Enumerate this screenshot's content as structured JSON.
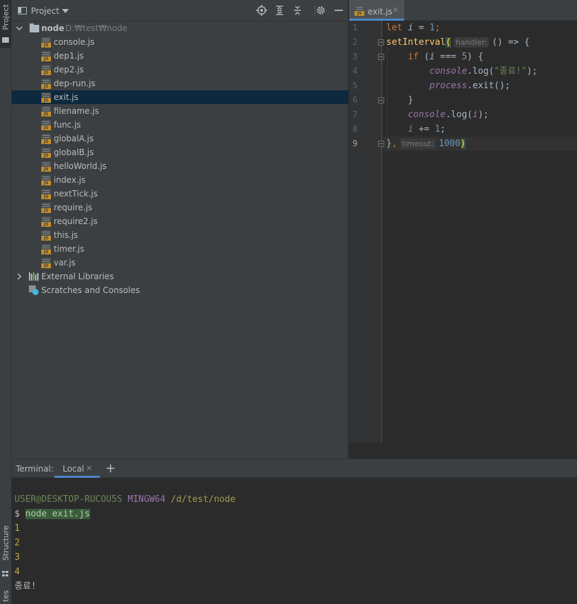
{
  "sidebar_strip": {
    "project_label": "Project",
    "structure_label": "Structure",
    "favorites_label": "tes"
  },
  "project_panel": {
    "title": "Project",
    "root": {
      "name": "node",
      "path": "D:₩test₩node"
    },
    "files": [
      "console.js",
      "dep1.js",
      "dep2.js",
      "dep-run.js",
      "exit.js",
      "filename.js",
      "func.js",
      "globalA.js",
      "globalB.js",
      "helloWorld.js",
      "index.js",
      "nextTick.js",
      "require.js",
      "require2.js",
      "this.js",
      "timer.js",
      "var.js"
    ],
    "selected_file": "exit.js",
    "external_libraries": "External Libraries",
    "scratches": "Scratches and Consoles",
    "icons": [
      "locate-icon",
      "expand-all-icon",
      "collapse-all-icon",
      "gear-icon",
      "minimize-icon"
    ]
  },
  "editor": {
    "tab_label": "exit.js",
    "line_numbers": [
      "1",
      "2",
      "3",
      "4",
      "5",
      "6",
      "7",
      "8",
      "9"
    ],
    "current_line": "9",
    "code": {
      "l1": {
        "kw": "let",
        "var": "i",
        "eq": " = ",
        "num": "1",
        "end": ";"
      },
      "l2": {
        "fn": "setInterval",
        "paren": "(",
        "hint": "handler:",
        "rest": "() => {"
      },
      "l3": {
        "kw": "if",
        "open": " (",
        "var": "i",
        "op": " === ",
        "num": "5",
        "close": ") {"
      },
      "l4": {
        "obj": "console",
        "dot": ".log(",
        "str": "\"종료!\"",
        "end": ");"
      },
      "l5": {
        "obj": "process",
        "rest": ".exit();"
      },
      "l6": {
        "text": "}"
      },
      "l7": {
        "obj": "console",
        "dot": ".log(",
        "var": "i",
        "end": ");"
      },
      "l8": {
        "var": "i",
        "op": " += ",
        "num": "1",
        "end": ";"
      },
      "l9": {
        "brace": "}",
        "comma": ",",
        "hint": "timeout:",
        "num": "1000",
        "close": ")"
      }
    }
  },
  "terminal": {
    "title": "Terminal:",
    "tab_label": "Local",
    "add_label": "+",
    "prompt_user": "USER@DESKTOP-RUCOU5S",
    "prompt_env": "MINGW64",
    "prompt_path": "/d/test/node",
    "prompt_symbol": "$",
    "command": "node exit.js",
    "output": [
      "1",
      "2",
      "3",
      "4"
    ],
    "final_output": "종료!"
  }
}
